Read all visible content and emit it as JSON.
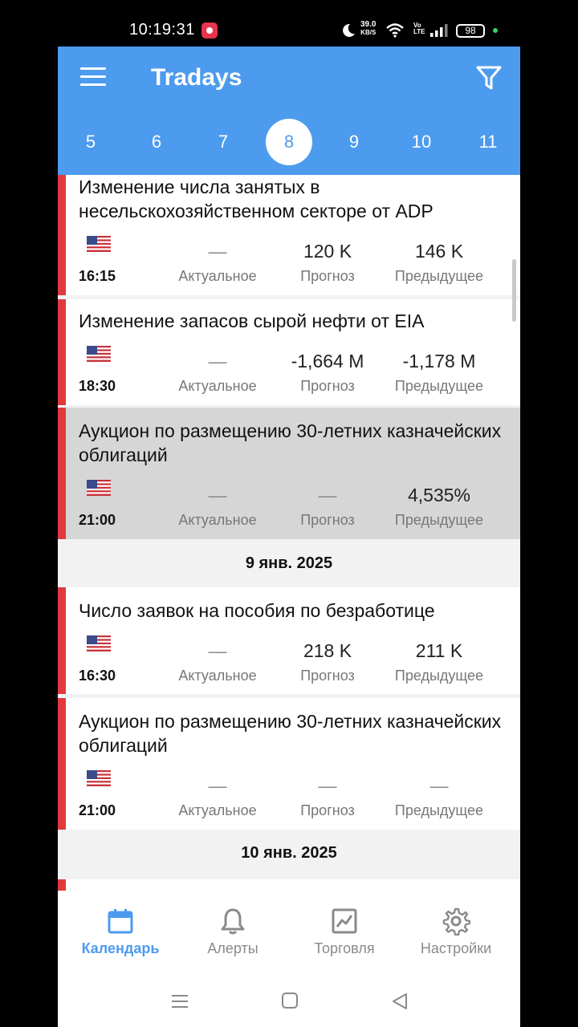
{
  "status_bar": {
    "time": "10:19:31",
    "net_speed": "39.0",
    "net_unit": "KB/S",
    "volte": "Vo",
    "lte": "LTE",
    "battery": "98"
  },
  "app": {
    "title": "Tradays",
    "accent": "#4d9bee",
    "importance_color": "#e03a3e"
  },
  "days": [
    {
      "label": "5"
    },
    {
      "label": "6"
    },
    {
      "label": "7"
    },
    {
      "label": "8"
    },
    {
      "label": "9"
    },
    {
      "label": "10"
    },
    {
      "label": "11"
    }
  ],
  "labels": {
    "actual": "Актуальное",
    "forecast": "Прогноз",
    "previous": "Предыдущее"
  },
  "events": [
    {
      "title": "Изменение числа занятых в несельскохозяйственном секторе от ADP",
      "time": "16:15",
      "actual": "—",
      "forecast": "120 K",
      "previous": "146 K",
      "country": "us-flag"
    },
    {
      "title": "Изменение запасов сырой нефти от EIA",
      "time": "18:30",
      "actual": "—",
      "forecast": "-1,664 M",
      "previous": "-1,178 M",
      "country": "us-flag"
    },
    {
      "title": "Аукцион по размещению 30-летних казначейских облигаций",
      "time": "21:00",
      "actual": "—",
      "forecast": "—",
      "previous": "4,535%",
      "country": "us-flag"
    },
    {
      "title": "Число заявок на пособия по безработице",
      "time": "16:30",
      "actual": "—",
      "forecast": "218 K",
      "previous": "211 K",
      "country": "us-flag"
    },
    {
      "title": "Аукцион по размещению 30-летних казначейских облигаций",
      "time": "21:00",
      "actual": "—",
      "forecast": "—",
      "previous": "—",
      "country": "us-flag"
    }
  ],
  "date_headers": [
    "9 янв. 2025",
    "10 янв. 2025"
  ],
  "bottom_nav": [
    {
      "label": "Календарь",
      "icon": "calendar-icon"
    },
    {
      "label": "Алерты",
      "icon": "bell-icon"
    },
    {
      "label": "Торговля",
      "icon": "chart-icon"
    },
    {
      "label": "Настройки",
      "icon": "gear-icon"
    }
  ]
}
